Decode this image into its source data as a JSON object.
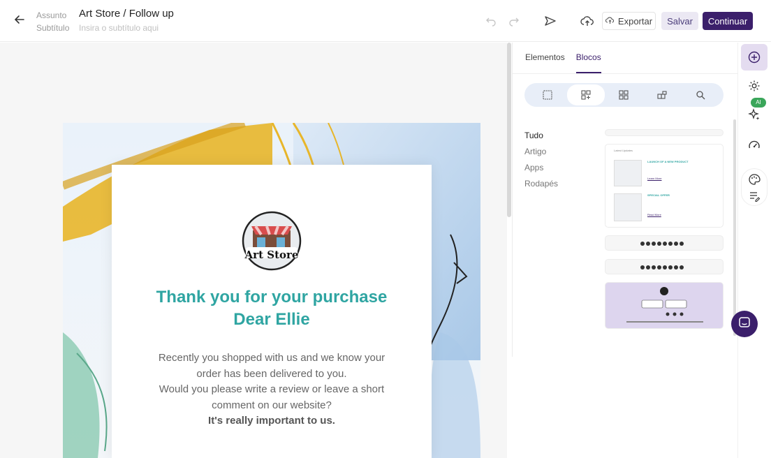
{
  "header": {
    "subject_label": "Assunto",
    "subtitle_label": "Subtítulo",
    "title": "Art Store / Follow up",
    "subtitle_placeholder": "Insira o subtítulo aqui",
    "export_label": "Exportar",
    "save_label": "Salvar",
    "continue_label": "Continuar"
  },
  "panel": {
    "tabs": [
      {
        "label": "Elementos",
        "active": false
      },
      {
        "label": "Blocos",
        "active": true
      }
    ],
    "categories": [
      "Tudo",
      "Artigo",
      "Apps",
      "Rodapés"
    ],
    "thumb": {
      "latest_updates": "Latest Updates",
      "item1_title": "LAUNCH OF A NEW PRODUCT",
      "item1_link": "Learn More",
      "item2_title": "SPECIAL OFFER",
      "item2_link": "Read More"
    }
  },
  "rail": {
    "ai_badge": "AI"
  },
  "email": {
    "logo_text": "Art Store",
    "heading_line1": "Thank you for your purchase",
    "heading_line2": "Dear Ellie",
    "body_line1": "Recently you shopped with us and we know your",
    "body_line2": "order has been delivered to you.",
    "body_line3": "Would you please write a review or leave a short",
    "body_line4": "comment on our website?",
    "body_strong": "It's really important to us."
  },
  "colors": {
    "brand": "#3b1f6b",
    "heading": "#2fa5a2",
    "accent_yellow": "#e8b62a"
  }
}
